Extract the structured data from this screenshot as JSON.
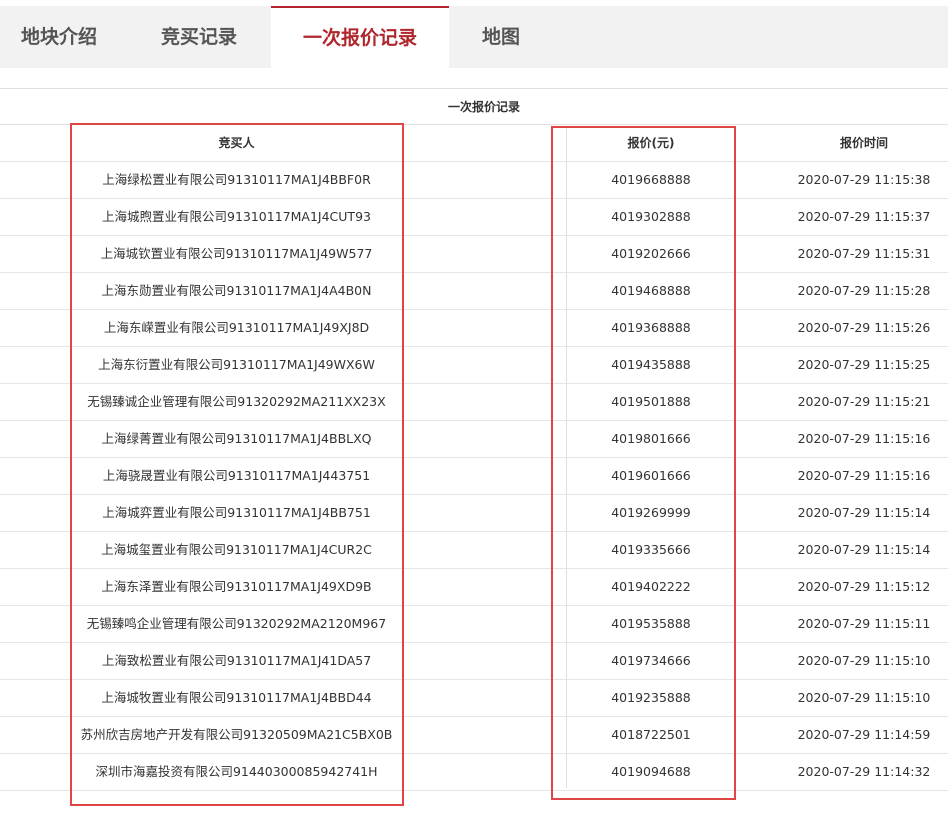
{
  "tabs": [
    {
      "label": "地块介绍",
      "active": false
    },
    {
      "label": "竞买记录",
      "active": false
    },
    {
      "label": "一次报价记录",
      "active": true
    },
    {
      "label": "地图",
      "active": false
    }
  ],
  "table": {
    "caption": "一次报价记录",
    "headers": {
      "bidder": "竞买人",
      "price": "报价(元)",
      "time": "报价时间"
    },
    "rows": [
      {
        "bidder": "上海绿松置业有限公司91310117MA1J4BBF0R",
        "price": "4019668888",
        "time": "2020-07-29 11:15:38"
      },
      {
        "bidder": "上海城煦置业有限公司91310117MA1J4CUT93",
        "price": "4019302888",
        "time": "2020-07-29 11:15:37"
      },
      {
        "bidder": "上海城钦置业有限公司91310117MA1J49W577",
        "price": "4019202666",
        "time": "2020-07-29 11:15:31"
      },
      {
        "bidder": "上海东勋置业有限公司91310117MA1J4A4B0N",
        "price": "4019468888",
        "time": "2020-07-29 11:15:28"
      },
      {
        "bidder": "上海东嵘置业有限公司91310117MA1J49XJ8D",
        "price": "4019368888",
        "time": "2020-07-29 11:15:26"
      },
      {
        "bidder": "上海东衍置业有限公司91310117MA1J49WX6W",
        "price": "4019435888",
        "time": "2020-07-29 11:15:25"
      },
      {
        "bidder": "无锡臻诚企业管理有限公司91320292MA211XX23X",
        "price": "4019501888",
        "time": "2020-07-29 11:15:21"
      },
      {
        "bidder": "上海绿菁置业有限公司91310117MA1J4BBLXQ",
        "price": "4019801666",
        "time": "2020-07-29 11:15:16"
      },
      {
        "bidder": "上海骁晟置业有限公司91310117MA1J443751",
        "price": "4019601666",
        "time": "2020-07-29 11:15:16"
      },
      {
        "bidder": "上海城弈置业有限公司91310117MA1J4BB751",
        "price": "4019269999",
        "time": "2020-07-29 11:15:14"
      },
      {
        "bidder": "上海城玺置业有限公司91310117MA1J4CUR2C",
        "price": "4019335666",
        "time": "2020-07-29 11:15:14"
      },
      {
        "bidder": "上海东泽置业有限公司91310117MA1J49XD9B",
        "price": "4019402222",
        "time": "2020-07-29 11:15:12"
      },
      {
        "bidder": "无锡臻鸣企业管理有限公司91320292MA2120M967",
        "price": "4019535888",
        "time": "2020-07-29 11:15:11"
      },
      {
        "bidder": "上海致松置业有限公司91310117MA1J41DA57",
        "price": "4019734666",
        "time": "2020-07-29 11:15:10"
      },
      {
        "bidder": "上海城牧置业有限公司91310117MA1J4BBD44",
        "price": "4019235888",
        "time": "2020-07-29 11:15:10"
      },
      {
        "bidder": "苏州欣吉房地产开发有限公司91320509MA21C5BX0B",
        "price": "4018722501",
        "time": "2020-07-29 11:14:59"
      },
      {
        "bidder": "深圳市海嘉投资有限公司91440300085942741H",
        "price": "4019094688",
        "time": "2020-07-29 11:14:32"
      }
    ]
  },
  "colors": {
    "accent": "#b0262c",
    "highlight": "#e04545",
    "tab_bar": "#f2f2f2"
  }
}
